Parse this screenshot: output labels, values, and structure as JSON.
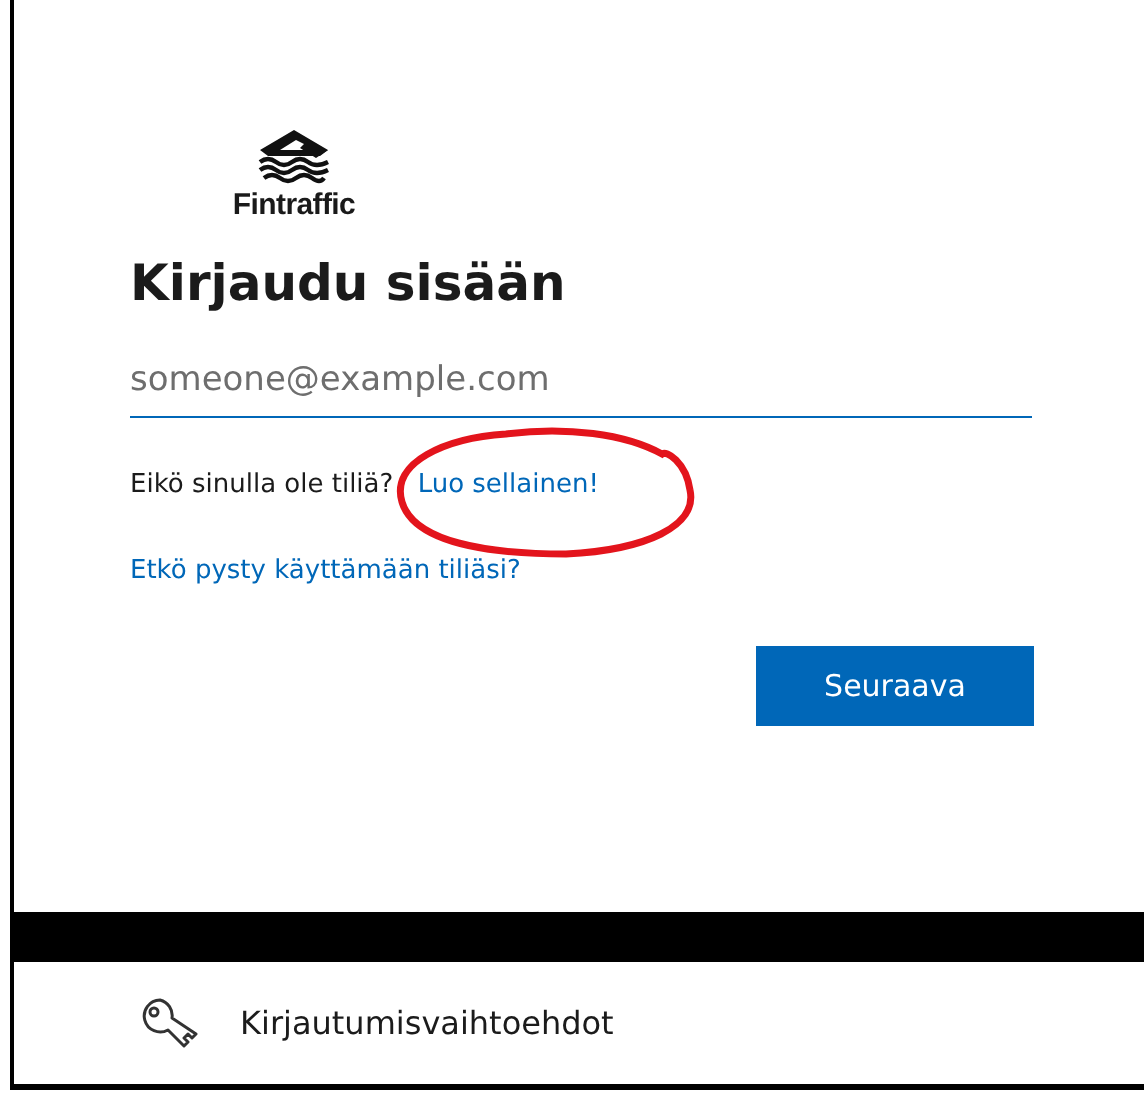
{
  "logo": {
    "name": "Fintraffic"
  },
  "title": "Kirjaudu sisään",
  "email_field": {
    "placeholder": "someone@example.com"
  },
  "no_account": {
    "text": "Eikö sinulla ole tiliä?",
    "link": "Luo sellainen!"
  },
  "cant_access_link": "Etkö pysty käyttämään tiliäsi?",
  "next_button": "Seuraava",
  "annotation": {
    "kind": "circle"
  },
  "sign_in_options": "Kirjautumisvaihtoehdot"
}
